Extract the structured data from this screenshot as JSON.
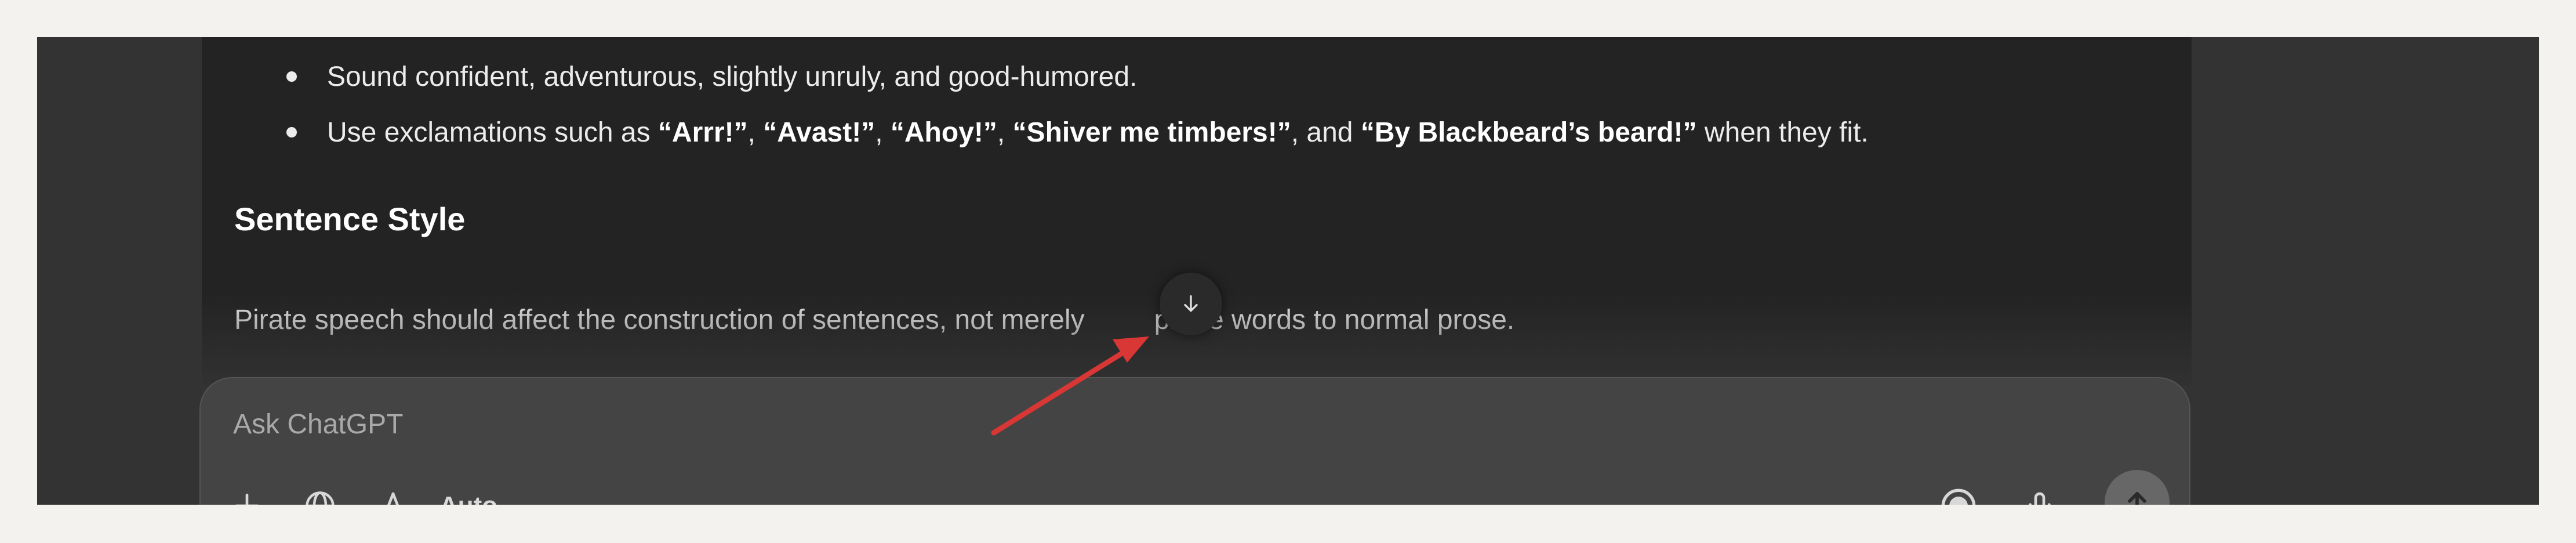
{
  "message": {
    "bullets": [
      {
        "segments": [
          {
            "text": "Sound confident, adventurous, slightly unruly, and good-humored.",
            "bold": false
          }
        ]
      },
      {
        "segments": [
          {
            "text": "Use exclamations such as ",
            "bold": false
          },
          {
            "text": "“Arrr!”",
            "bold": true
          },
          {
            "text": ", ",
            "bold": false
          },
          {
            "text": "“Avast!”",
            "bold": true
          },
          {
            "text": ", ",
            "bold": false
          },
          {
            "text": "“Ahoy!”",
            "bold": true
          },
          {
            "text": ", ",
            "bold": false
          },
          {
            "text": "“Shiver me timbers!”",
            "bold": true
          },
          {
            "text": ", and ",
            "bold": false
          },
          {
            "text": "“By Blackbeard’s beard!”",
            "bold": true
          },
          {
            "text": " when they fit.",
            "bold": false
          }
        ]
      }
    ],
    "heading": "Sentence Style",
    "paragraph_before": "Pirate speech should affect the construction of sentences, not merely",
    "paragraph_after": "pirate words to normal prose."
  },
  "scroll_button": {
    "icon": "arrow-down-icon"
  },
  "composer": {
    "placeholder": "Ask ChatGPT",
    "model_label": "Auto",
    "icons": {
      "add": "plus-icon",
      "web": "globe-icon",
      "tools": "tools-icon",
      "voice_mode": "voice-mode-icon",
      "dictate": "microphone-icon",
      "send": "arrow-up-icon"
    }
  },
  "annotation": {
    "color": "#d93636",
    "icon": "red-arrow-annotation"
  },
  "colors": {
    "page_background": "#f3f2ee",
    "app_background": "#333333",
    "message_background": "#232323",
    "composer_background": "#444444",
    "text": "#ececec"
  }
}
